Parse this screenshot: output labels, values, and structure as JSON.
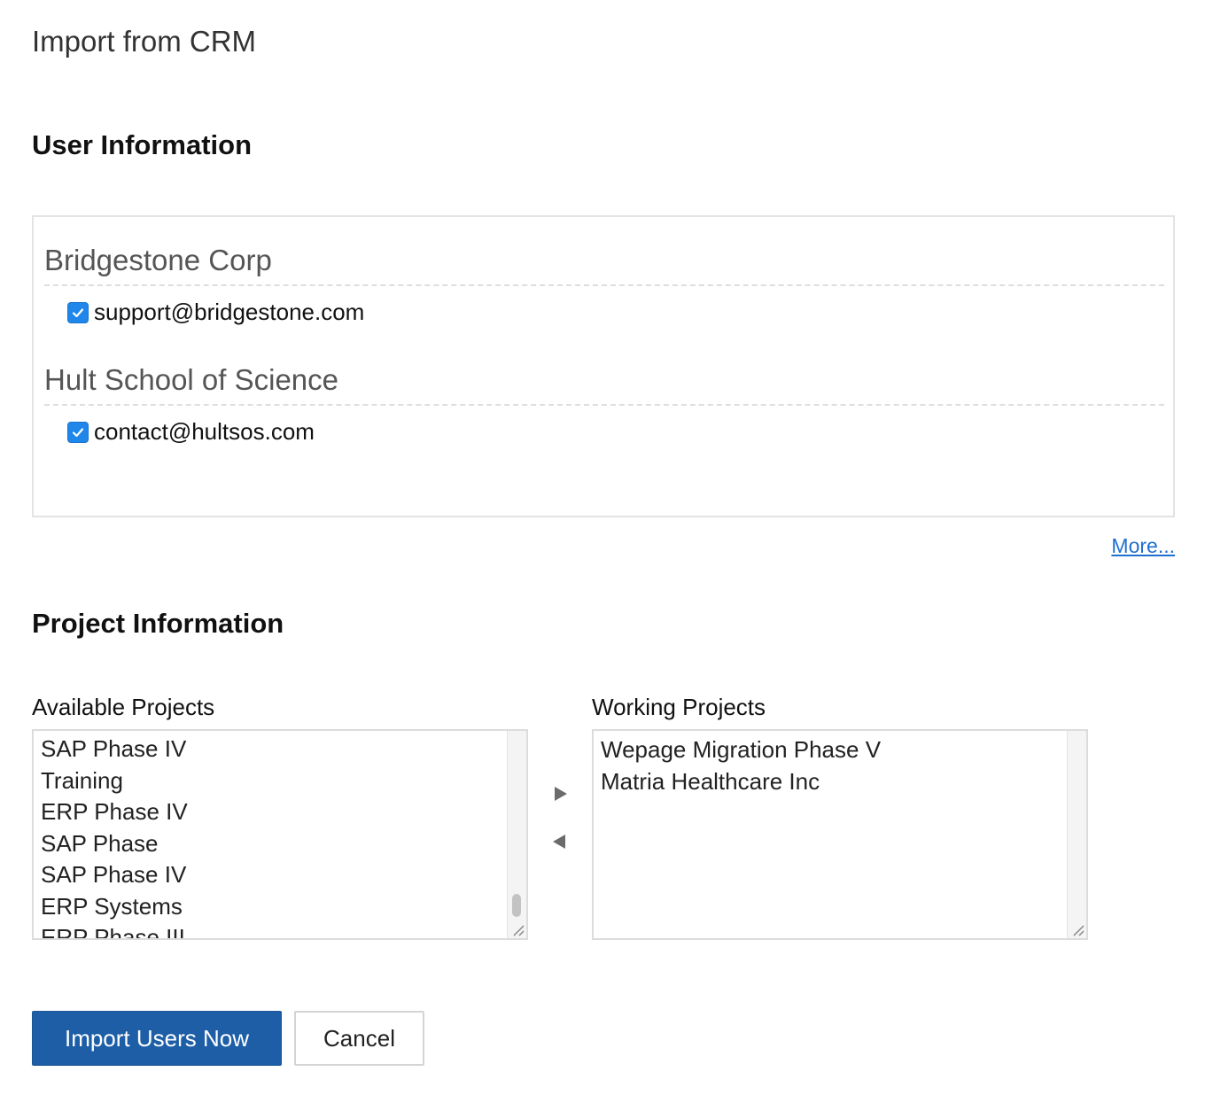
{
  "page": {
    "title": "Import from CRM"
  },
  "user_section": {
    "title": "User Information",
    "orgs": [
      {
        "name": "Bridgestone Corp",
        "email": "support@bridgestone.com",
        "checked": true
      },
      {
        "name": "Hult School of Science",
        "email": "contact@hultsos.com",
        "checked": true
      }
    ],
    "more_link": "More..."
  },
  "project_section": {
    "title": "Project Information",
    "available_label": "Available Projects",
    "working_label": "Working Projects",
    "available": [
      "SAP Phase IV",
      "Training",
      "ERP Phase IV",
      "SAP Phase",
      "SAP Phase IV",
      "ERP Systems",
      "ERP Phase III"
    ],
    "working": [
      "Wepage Migration Phase V",
      "Matria Healthcare Inc"
    ]
  },
  "actions": {
    "primary_label": "Import Users Now",
    "cancel_label": "Cancel"
  },
  "colors": {
    "primary": "#1d5ea7",
    "link": "#1f6fd1",
    "checkbox": "#1f86ea"
  }
}
